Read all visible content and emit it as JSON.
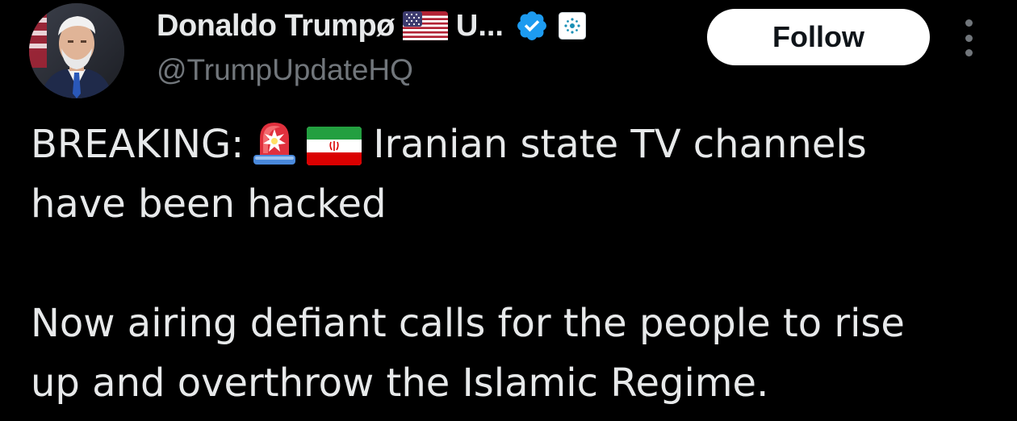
{
  "author": {
    "display_name": "Donaldo Trumpø",
    "name_truncated": "U...",
    "handle": "@TrumpUpdateHQ",
    "avatar_icon": "portrait-avatar",
    "flag_icon": "us-flag-icon",
    "verified_icon": "verified-badge-icon",
    "affiliate_icon": "affiliate-badge-icon",
    "verified_color": "#1d9bf0"
  },
  "actions": {
    "follow_label": "Follow",
    "more_icon": "more-options-icon"
  },
  "tweet": {
    "line1_prefix": "BREAKING:",
    "line1_emoji_1": "police-siren-icon",
    "line1_emoji_2": "iran-flag-icon",
    "line1_suffix": "Iranian state TV channels",
    "line2": "have been hacked",
    "line3": "Now airing defiant calls for the people to rise",
    "line4": "up and overthrow the Islamic Regime."
  },
  "colors": {
    "background": "#000000",
    "text": "#e7e9ea",
    "secondary_text": "#71767b",
    "follow_bg": "#ffffff",
    "follow_text": "#0f1419"
  }
}
